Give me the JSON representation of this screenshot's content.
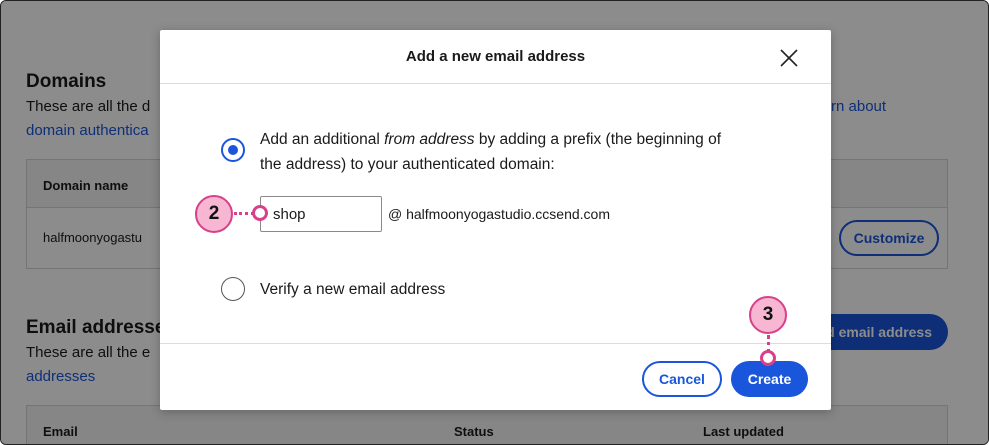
{
  "background": {
    "domains": {
      "heading": "Domains",
      "desc_start": "These are all the d",
      "link_right": "rn about",
      "link_left": "domain authentica",
      "table": {
        "header": "Domain name",
        "row_domain": "halfmoonyogastu",
        "customize_label": "Customize"
      }
    },
    "email_addresses": {
      "heading": "Email addresse",
      "desc_start": "These are all the e",
      "link": "addresses",
      "add_button_label": "d email address",
      "table": {
        "columns": [
          "Email",
          "Status",
          "Last updated"
        ]
      }
    }
  },
  "modal": {
    "title": "Add a new email address",
    "option_prefix": {
      "line1_pre": "Add an additional ",
      "line1_em": "from address",
      "line1_post": " by adding a prefix (the beginning of",
      "line2": "the address) to your authenticated domain:",
      "checked": true
    },
    "prefix_input_value": "shop",
    "domain_suffix": "@  halfmoonyogastudio.ccsend.com",
    "option_verify": {
      "label": "Verify a new email address",
      "checked": false
    },
    "cancel_label": "Cancel",
    "create_label": "Create"
  },
  "callouts": [
    "2",
    "3"
  ],
  "colors": {
    "accent": "#1a56db",
    "callout_fill": "#f7b6d2",
    "callout_border": "#d9408a"
  }
}
